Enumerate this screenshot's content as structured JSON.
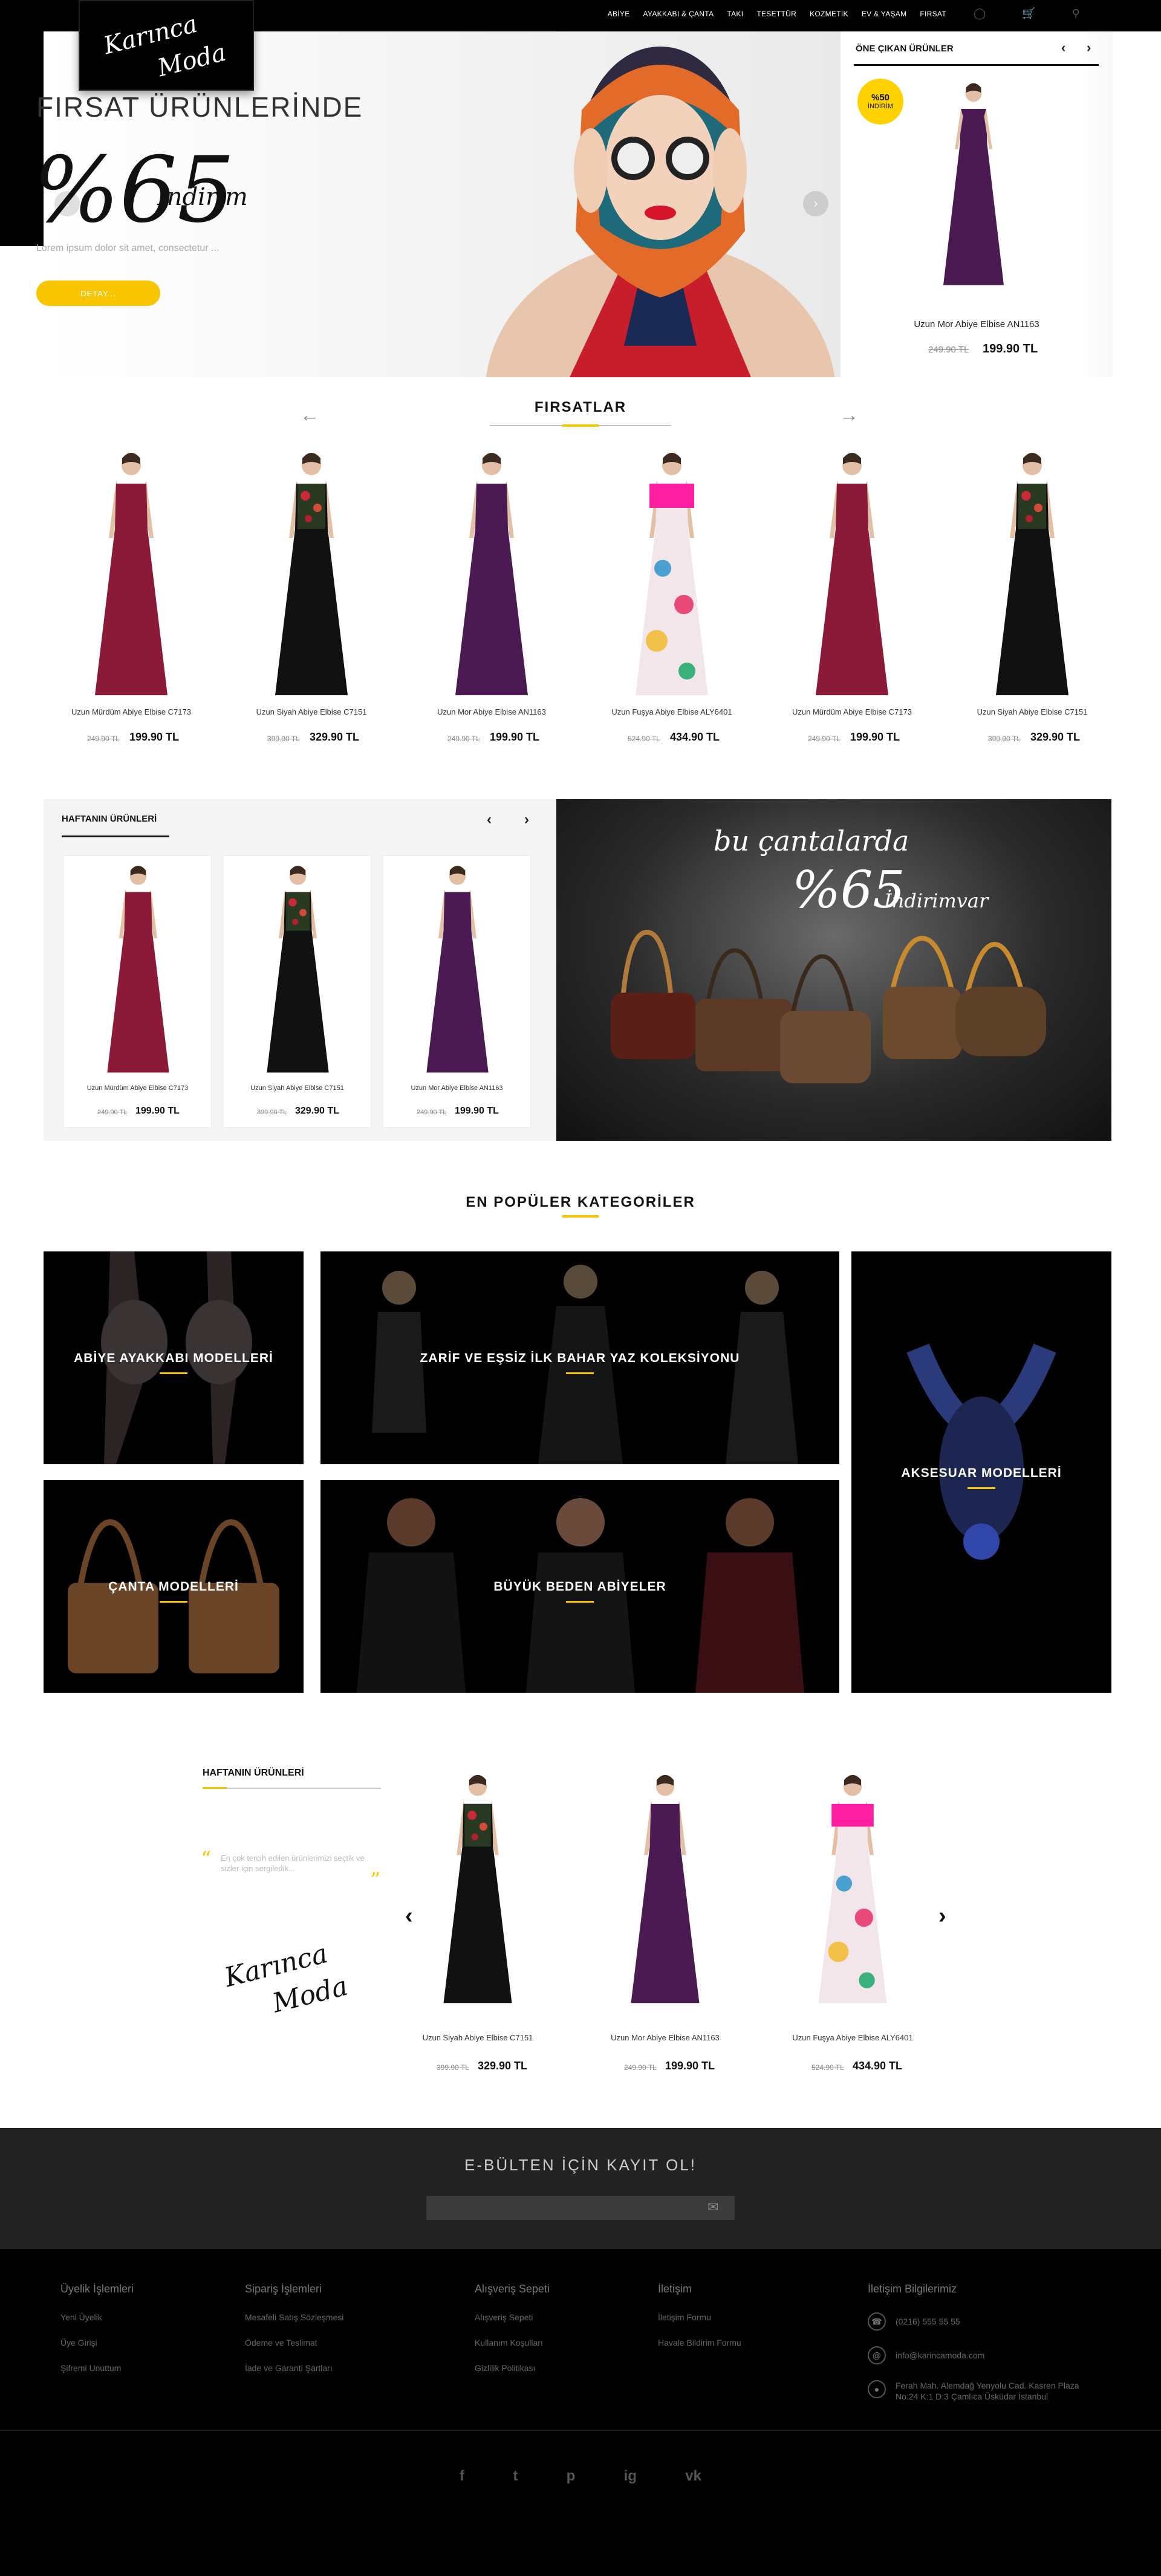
{
  "brand": {
    "logo_line1": "Karınca",
    "logo_line2": "Moda"
  },
  "nav": [
    "ABİYE",
    "AYAKKABI & ÇANTA",
    "TAKI",
    "TESETTÜR",
    "KOZMETİK",
    "EV & YAŞAM",
    "FIRSAT"
  ],
  "header_icons": [
    "user-icon",
    "cart-icon",
    "search-icon"
  ],
  "hero": {
    "title": "FIRSAT ÜRÜNLERİNDE",
    "percent": "%65",
    "discount_word": "İndirim",
    "description": "Lorem ipsum dolor sit amet, consectetur ...",
    "button": "DETAY..."
  },
  "featured": {
    "title": "ÖNE ÇIKAN ÜRÜNLER",
    "badge_pct": "%50",
    "badge_text": "İNDİRİM",
    "product_name": "Uzun Mor Abiye Elbise AN1163",
    "old_price": "249.90 TL",
    "new_price": "199.90 TL"
  },
  "firsatlar": {
    "title": "FIRSATLAR",
    "products": [
      {
        "name": "Uzun Mürdüm Abiye Elbise C7173",
        "old": "249.90 TL",
        "new": "199.90 TL"
      },
      {
        "name": "Uzun Siyah Abiye Elbise C7151",
        "old": "399.90 TL",
        "new": "329.90 TL"
      },
      {
        "name": "Uzun Mor Abiye Elbise AN1163",
        "old": "249.90 TL",
        "new": "199.90 TL"
      },
      {
        "name": "Uzun Fuşya Abiye Elbise ALY6401",
        "old": "524.90 TL",
        "new": "434.90 TL"
      },
      {
        "name": "Uzun Mürdüm Abiye Elbise C7173",
        "old": "249.90 TL",
        "new": "199.90 TL"
      },
      {
        "name": "Uzun Siyah Abiye Elbise C7151",
        "old": "399.90 TL",
        "new": "329.90 TL"
      }
    ]
  },
  "weekly": {
    "title": "HAFTANIN ÜRÜNLERİ",
    "products": [
      {
        "name": "Uzun Mürdüm Abiye Elbise C7173",
        "old": "249.90 TL",
        "new": "199.90 TL"
      },
      {
        "name": "Uzun Siyah Abiye Elbise C7151",
        "old": "399.90 TL",
        "new": "329.90 TL"
      },
      {
        "name": "Uzun Mor Abiye Elbise AN1163",
        "old": "249.90 TL",
        "new": "199.90 TL"
      }
    ]
  },
  "bag_banner": {
    "line1": "bu çantalarda",
    "percent": "%65",
    "discount_word": "İndirimvar"
  },
  "categories": {
    "title": "EN POPÜLER KATEGORİLER",
    "items": [
      "ABİYE AYAKKABI MODELLERİ",
      "ZARİF VE EŞSİZ İLK BAHAR YAZ KOLEKSİYONU",
      "AKSESUAR MODELLERİ",
      "ÇANTA MODELLERİ",
      "BÜYÜK BEDEN ABİYELER"
    ]
  },
  "bottom_weekly": {
    "title": "HAFTANIN ÜRÜNLERİ",
    "quote": "En çok tercih edilen ürünlerimizi seçtik ve sizler için sergiledik...",
    "products": [
      {
        "name": "Uzun Siyah Abiye Elbise C7151",
        "old": "399.90 TL",
        "new": "329.90 TL"
      },
      {
        "name": "Uzun Mor Abiye Elbise AN1163",
        "old": "249.90 TL",
        "new": "199.90 TL"
      },
      {
        "name": "Uzun Fuşya Abiye Elbise ALY6401",
        "old": "524.90 TL",
        "new": "434.90 TL"
      }
    ]
  },
  "newsletter": {
    "title": "E-BÜLTEN İÇİN KAYIT OL!",
    "placeholder": ""
  },
  "footer": {
    "col1": {
      "title": "Üyelik İşlemleri",
      "items": [
        "Yeni Üyelik",
        "Üye Girişi",
        "Şifremi Unuttum"
      ]
    },
    "col2": {
      "title": "Sipariş İşlemleri",
      "items": [
        "Mesafeli Satış Sözleşmesi",
        "Ödeme ve Teslimat",
        "İade ve Garanti Şartları"
      ]
    },
    "col3": {
      "title": "Alışveriş Sepeti",
      "items": [
        "Alışveriş Sepeti",
        "Kullanım Koşulları",
        "Gizlilik Politikası"
      ]
    },
    "col4": {
      "title": "İletişim",
      "items": [
        "İletişim Formu",
        "Havale Bildirim Formu"
      ]
    },
    "contact": {
      "title": "İletişim Bilgilerimiz",
      "phone": "(0216) 555 55 55",
      "email": "info@karincamoda.com",
      "address": "Ferah Mah. Alemdağ Yenyolu Cad. Kasren Plaza No:24 K:1 D:3 Çamlıca Üsküdar İstanbul"
    },
    "social": [
      "f",
      "t",
      "p",
      "ig",
      "vk"
    ]
  },
  "colors": {
    "accent": "#f7c600",
    "dark": "#000000",
    "wine": "#8b1a38",
    "purple": "#4b1a52",
    "fuchsia": "#e2197a"
  }
}
